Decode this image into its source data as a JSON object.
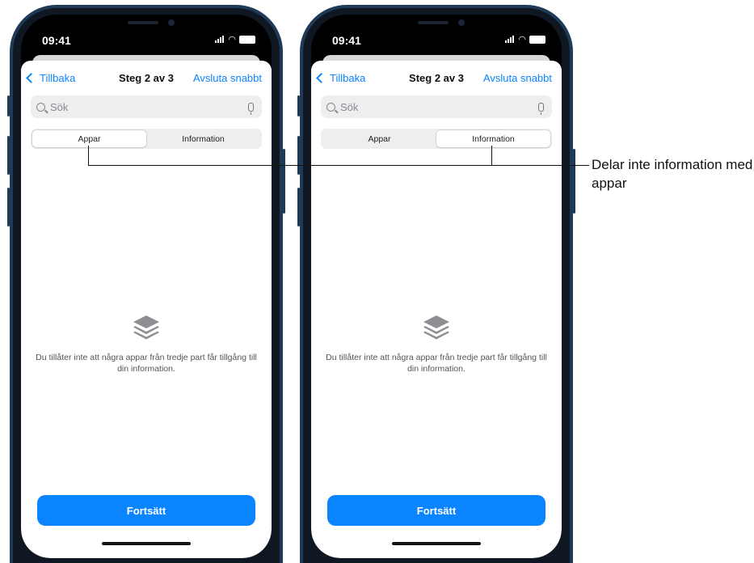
{
  "phones": [
    {
      "status_time": "09:41",
      "back_label": "Tillbaka",
      "title": "Steg 2 av 3",
      "quick_exit": "Avsluta snabbt",
      "search_placeholder": "Sök",
      "segments": [
        "Appar",
        "Information"
      ],
      "active_segment": "Appar",
      "empty_message": "Du tillåter inte att några appar från tredje part får tillgång till din information.",
      "continue_label": "Fortsätt"
    },
    {
      "status_time": "09:41",
      "back_label": "Tillbaka",
      "title": "Steg 2 av 3",
      "quick_exit": "Avsluta snabbt",
      "search_placeholder": "Sök",
      "segments": [
        "Appar",
        "Information"
      ],
      "active_segment": "Information",
      "empty_message": "Du tillåter inte att några appar från tredje part får tillgång till din information.",
      "continue_label": "Fortsätt"
    }
  ],
  "callout": {
    "text": "Delar inte information med appar"
  },
  "colors": {
    "accent": "#0a84ff",
    "frame": "#1e3a56"
  }
}
